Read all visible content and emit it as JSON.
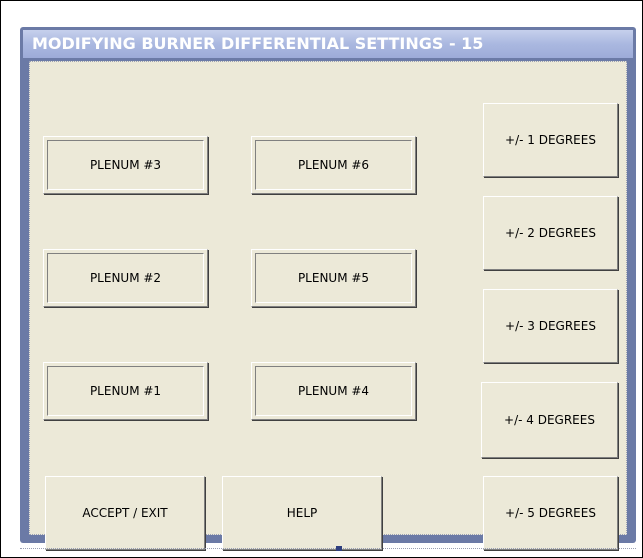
{
  "window": {
    "title": "MODIFYING BURNER DIFFERENTIAL SETTINGS - 15"
  },
  "plenums": {
    "p3": "PLENUM #3",
    "p6": "PLENUM #6",
    "p2": "PLENUM #2",
    "p5": "PLENUM #5",
    "p1": "PLENUM #1",
    "p4": "PLENUM #4"
  },
  "degrees": {
    "d1": "+/- 1 DEGREES",
    "d2": "+/- 2 DEGREES",
    "d3": "+/- 3 DEGREES",
    "d4": "+/- 4 DEGREES",
    "d5": "+/- 5 DEGREES"
  },
  "actions": {
    "accept_exit": "ACCEPT / EXIT",
    "help": "HELP"
  },
  "colors": {
    "title_text": "#ffffff",
    "title_bar": "#aab8e0",
    "window_face": "#ece9d8"
  }
}
